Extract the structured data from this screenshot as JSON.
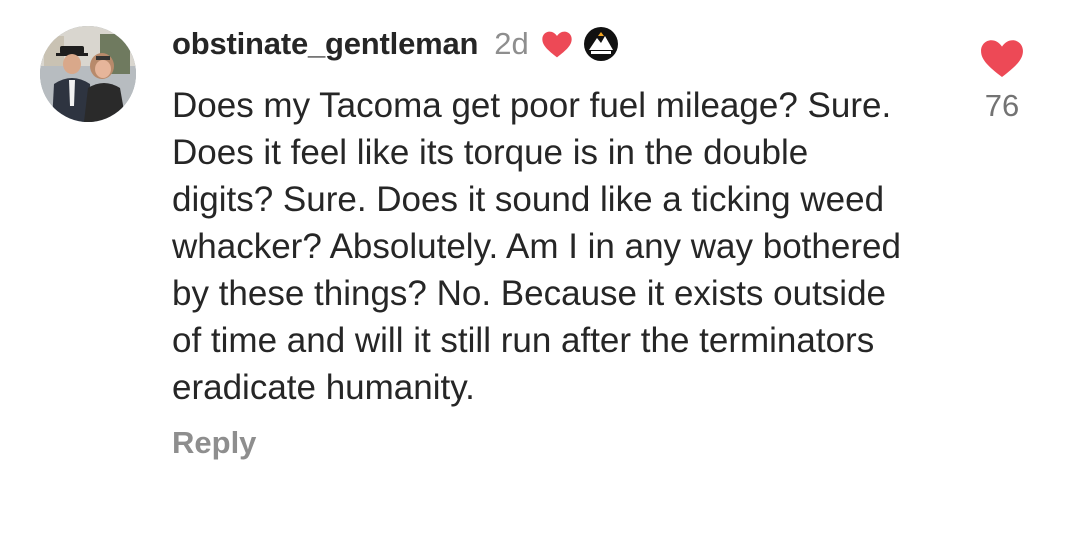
{
  "comment": {
    "username": "obstinate_gentleman",
    "time": "2d",
    "badge_icon": "mountain-badge-icon",
    "author_liked_icon": "heart-filled-icon",
    "text": "Does my Tacoma get poor fuel mileage? Sure. Does it feel like its torque is in the double digits? Sure. Does it sound like a ticking weed whacker? Absolutely. Am I in any way bothered by these things? No. Because it exists outside of time and will it still run after the terminators eradicate humanity.",
    "reply_label": "Reply",
    "like_count": "76",
    "like_icon": "heart-filled-icon"
  },
  "colors": {
    "heart": "#ed4956",
    "secondary_text": "#8e8e8e",
    "primary_text": "#262626"
  }
}
